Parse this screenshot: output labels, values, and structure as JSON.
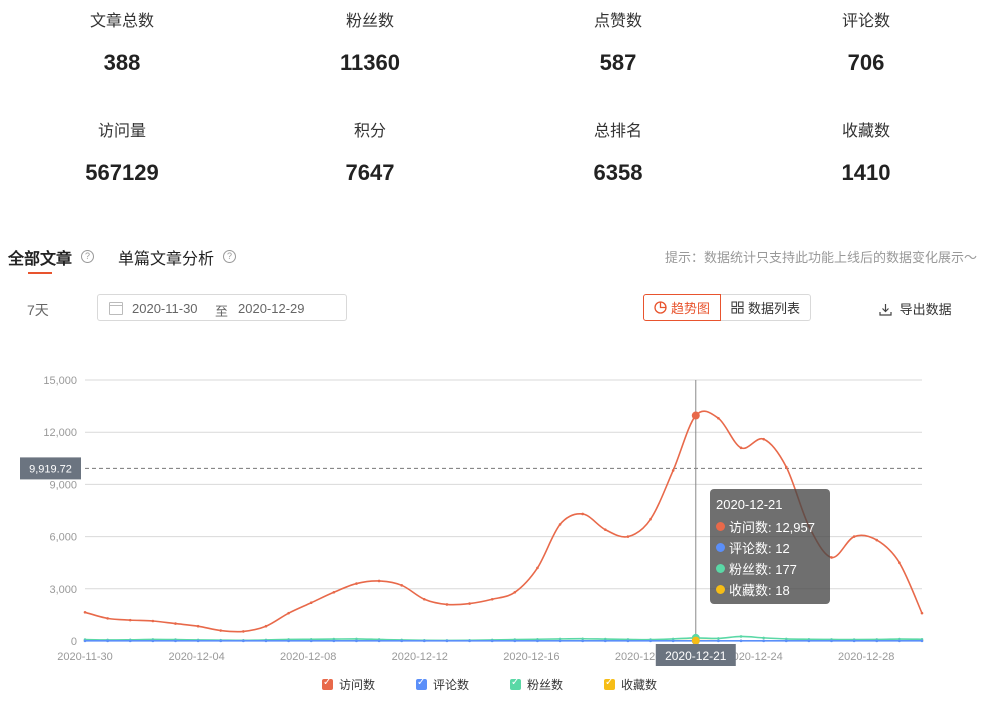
{
  "stats": [
    {
      "label": "文章总数",
      "value": "388"
    },
    {
      "label": "粉丝数",
      "value": "11360"
    },
    {
      "label": "点赞数",
      "value": "587"
    },
    {
      "label": "评论数",
      "value": "706"
    },
    {
      "label": "访问量",
      "value": "567129"
    },
    {
      "label": "积分",
      "value": "7647"
    },
    {
      "label": "总排名",
      "value": "6358"
    },
    {
      "label": "收藏数",
      "value": "1410"
    }
  ],
  "tabs": {
    "all": "全部文章",
    "single": "单篇文章分析"
  },
  "tip": "提示：数据统计只支持此功能上线后的数据变化展示～",
  "filter": {
    "range": "7天",
    "start": "2020-11-30",
    "sep": "至",
    "end": "2020-12-29"
  },
  "view": {
    "trend": "趋势图",
    "list": "数据列表",
    "export": "导出数据"
  },
  "colors": {
    "accent": "#e8542e",
    "visits": "#e8694a",
    "comments": "#5b8ff9",
    "fans": "#5ad8a6",
    "favorites": "#f6bd16"
  },
  "chart_data": {
    "type": "line",
    "x_labels": [
      "2020-11-30",
      "2020-12-04",
      "2020-12-08",
      "2020-12-12",
      "2020-12-16",
      "2020-12-20",
      "2020-12-24",
      "2020-12-28"
    ],
    "x_days": 30,
    "ylim": [
      0,
      15000
    ],
    "y_ticks": [
      "0",
      "3,000",
      "6,000",
      "9,000",
      "12,000",
      "15,000"
    ],
    "reference_value": 9919.72,
    "reference_label": "9,919.72",
    "series": [
      {
        "name": "访问数",
        "color": "#e8694a",
        "values": [
          1650,
          1300,
          1200,
          1150,
          1000,
          850,
          600,
          550,
          850,
          1600,
          2200,
          2800,
          3300,
          3450,
          3200,
          2400,
          2100,
          2150,
          2400,
          2800,
          4200,
          6700,
          7300,
          6400,
          6000,
          7000,
          9800,
          12957,
          12800,
          11100,
          11600,
          10000,
          6600,
          4800,
          6000,
          5800,
          4500,
          1600
        ]
      },
      {
        "name": "评论数",
        "color": "#5b8ff9",
        "values": [
          10,
          10,
          10,
          10,
          10,
          10,
          10,
          10,
          10,
          10,
          10,
          10,
          10,
          10,
          10,
          10,
          10,
          10,
          10,
          10,
          10,
          10,
          10,
          10,
          10,
          10,
          10,
          12,
          10,
          10,
          10,
          10,
          10,
          10,
          10,
          10,
          10,
          10
        ]
      },
      {
        "name": "粉丝数",
        "color": "#5ad8a6",
        "values": [
          80,
          60,
          70,
          90,
          80,
          60,
          50,
          40,
          60,
          90,
          100,
          110,
          120,
          90,
          60,
          40,
          30,
          40,
          60,
          80,
          100,
          120,
          130,
          110,
          90,
          80,
          120,
          177,
          150,
          260,
          180,
          120,
          100,
          90,
          80,
          90,
          110,
          100
        ]
      },
      {
        "name": "收藏数",
        "color": "#f6bd16",
        "values": [
          15,
          15,
          15,
          15,
          15,
          15,
          15,
          15,
          15,
          15,
          15,
          15,
          15,
          15,
          15,
          15,
          15,
          15,
          15,
          15,
          15,
          15,
          15,
          15,
          15,
          15,
          15,
          18,
          15,
          15,
          15,
          15,
          15,
          15,
          15,
          15,
          15,
          15
        ]
      }
    ],
    "tooltip": {
      "date": "2020-12-21",
      "rows": [
        {
          "label": "访问数: 12,957",
          "color": "#e8694a"
        },
        {
          "label": "评论数: 12",
          "color": "#5b8ff9"
        },
        {
          "label": "粉丝数: 177",
          "color": "#5ad8a6"
        },
        {
          "label": "收藏数: 18",
          "color": "#f6bd16"
        }
      ]
    },
    "crosshair_label": "2020-12-21",
    "legend": [
      "访问数",
      "评论数",
      "粉丝数",
      "收藏数"
    ]
  }
}
